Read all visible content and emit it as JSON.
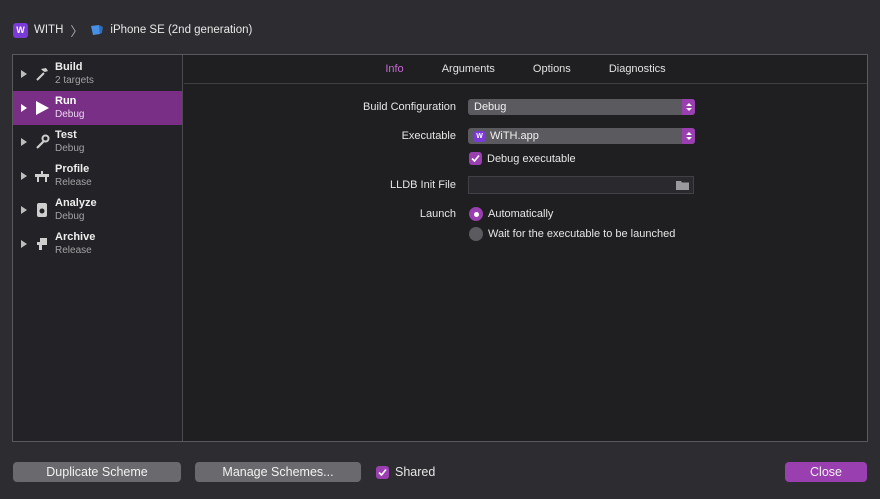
{
  "breadcrumb": {
    "app_badge": "W",
    "scheme": "WITH",
    "device": "iPhone SE (2nd generation)"
  },
  "sidebar": {
    "items": [
      {
        "title": "Build",
        "subtitle": "2 targets",
        "icon": "hammer-icon"
      },
      {
        "title": "Run",
        "subtitle": "Debug",
        "icon": "play-icon"
      },
      {
        "title": "Test",
        "subtitle": "Debug",
        "icon": "wrench-icon"
      },
      {
        "title": "Profile",
        "subtitle": "Release",
        "icon": "gauge-icon"
      },
      {
        "title": "Analyze",
        "subtitle": "Debug",
        "icon": "analyze-icon"
      },
      {
        "title": "Archive",
        "subtitle": "Release",
        "icon": "archive-icon"
      }
    ],
    "selected": "Run"
  },
  "tabs": [
    "Info",
    "Arguments",
    "Options",
    "Diagnostics"
  ],
  "active_tab": "Info",
  "form": {
    "build_configuration_label": "Build Configuration",
    "build_configuration_value": "Debug",
    "executable_label": "Executable",
    "executable_badge": "W",
    "executable_value": "WiTH.app",
    "debug_executable_label": "Debug executable",
    "debug_executable_checked": true,
    "lldb_label": "LLDB Init File",
    "lldb_value": "",
    "launch_label": "Launch",
    "launch_options": [
      "Automatically",
      "Wait for the executable to be launched"
    ],
    "launch_selected": "Automatically"
  },
  "footer": {
    "duplicate_label": "Duplicate Scheme",
    "manage_label": "Manage Schemes...",
    "shared_label": "Shared",
    "shared_checked": true,
    "close_label": "Close"
  },
  "colors": {
    "accent": "#9a3fb0",
    "selection": "#7a2f86",
    "active_tab": "#c56ad3",
    "app_badge": "#7a3ad6"
  }
}
